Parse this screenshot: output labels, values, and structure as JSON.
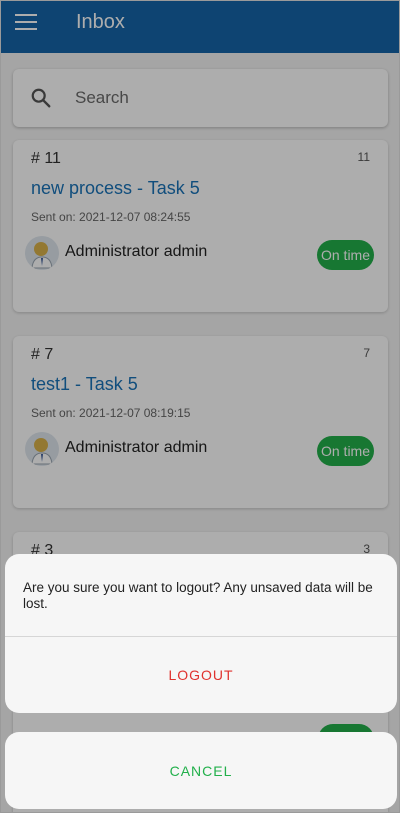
{
  "header": {
    "title": "Inbox",
    "menu_icon": "hamburger-menu-icon"
  },
  "search": {
    "placeholder": "Search",
    "icon": "search-icon"
  },
  "cards": [
    {
      "number": "# 11",
      "id": "11",
      "title": "new process - Task 5",
      "sent": "Sent on: 2021-12-07 08:24:55",
      "user": "Administrator admin",
      "status": "On time"
    },
    {
      "number": "# 7",
      "id": "7",
      "title": "test1 - Task 5",
      "sent": "Sent on: 2021-12-07 08:19:15",
      "user": "Administrator admin",
      "status": "On time"
    },
    {
      "number": "# 3",
      "id": "3"
    }
  ],
  "dialog": {
    "message": "Are you sure you want to logout? Any unsaved data will be lost.",
    "logout_label": "LOGOUT",
    "cancel_label": "CANCEL"
  },
  "colors": {
    "header": "#1565a8",
    "title_link": "#1a73b8",
    "status_badge": "#22b04b",
    "logout": "#e0322e",
    "cancel": "#22b04b"
  }
}
